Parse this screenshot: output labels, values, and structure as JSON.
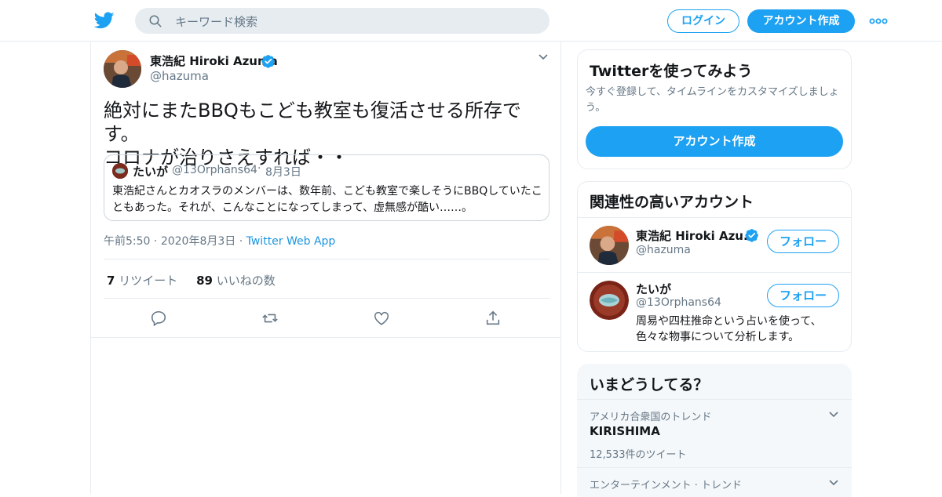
{
  "header": {
    "search_placeholder": "キーワード検索",
    "login_label": "ログイン",
    "signup_label": "アカウント作成"
  },
  "tweet": {
    "author_name": "東浩紀 Hiroki Azuma",
    "author_handle": "@hazuma",
    "text_line1": "絶対にまたBBQもこども教室も復活させる所存です。",
    "text_line2": "コロナが治りさえすれば・・",
    "quote": {
      "name": "たいが",
      "handle": "@13Orphans64",
      "separator": "·",
      "date": "8月3日",
      "text": "東浩紀さんとカオスラのメンバーは、数年前、こども教室で楽しそうにBBQしていたこともあった。それが、こんなことになってしまって、虚無感が酷い……。"
    },
    "time": "午前5:50",
    "meta_sep": "·",
    "date": "2020年8月3日",
    "client": "Twitter Web App",
    "retweet_count": "7",
    "retweet_label": "リツイート",
    "like_count": "89",
    "like_label": "いいねの数"
  },
  "sidebar": {
    "promo": {
      "title": "Twitterを使ってみよう",
      "subtitle": "今すぐ登録して、タイムラインをカスタマイズしましょう。",
      "button_label": "アカウント作成"
    },
    "related": {
      "title": "関連性の高いアカウント",
      "accounts": [
        {
          "name": "東浩紀 Hiroki Azu...",
          "handle": "@hazuma",
          "bio": "",
          "follow_label": "フォロー"
        },
        {
          "name": "たいが",
          "handle": "@13Orphans64",
          "bio": "周易や四柱推命という占いを使って、色々な物事について分析します。",
          "follow_label": "フォロー"
        }
      ]
    },
    "trends": {
      "title": "いまどうしてる？",
      "items": [
        {
          "category": "アメリカ合衆国のトレンド",
          "name": "KIRISHIMA",
          "count": "12,533件のツイート"
        },
        {
          "category": "エンターテインメント · トレンド",
          "name": "",
          "count": ""
        }
      ]
    }
  },
  "colors": {
    "accent": "#1da1f2",
    "link": "#1b95e0",
    "secondary_text": "#657786",
    "border": "#e6ecf0"
  },
  "icons": [
    "twitter-bird-icon",
    "search-icon",
    "more-dots-icon",
    "verified-badge-icon",
    "chevron-down-icon",
    "reply-icon",
    "retweet-icon",
    "like-icon",
    "share-icon"
  ]
}
